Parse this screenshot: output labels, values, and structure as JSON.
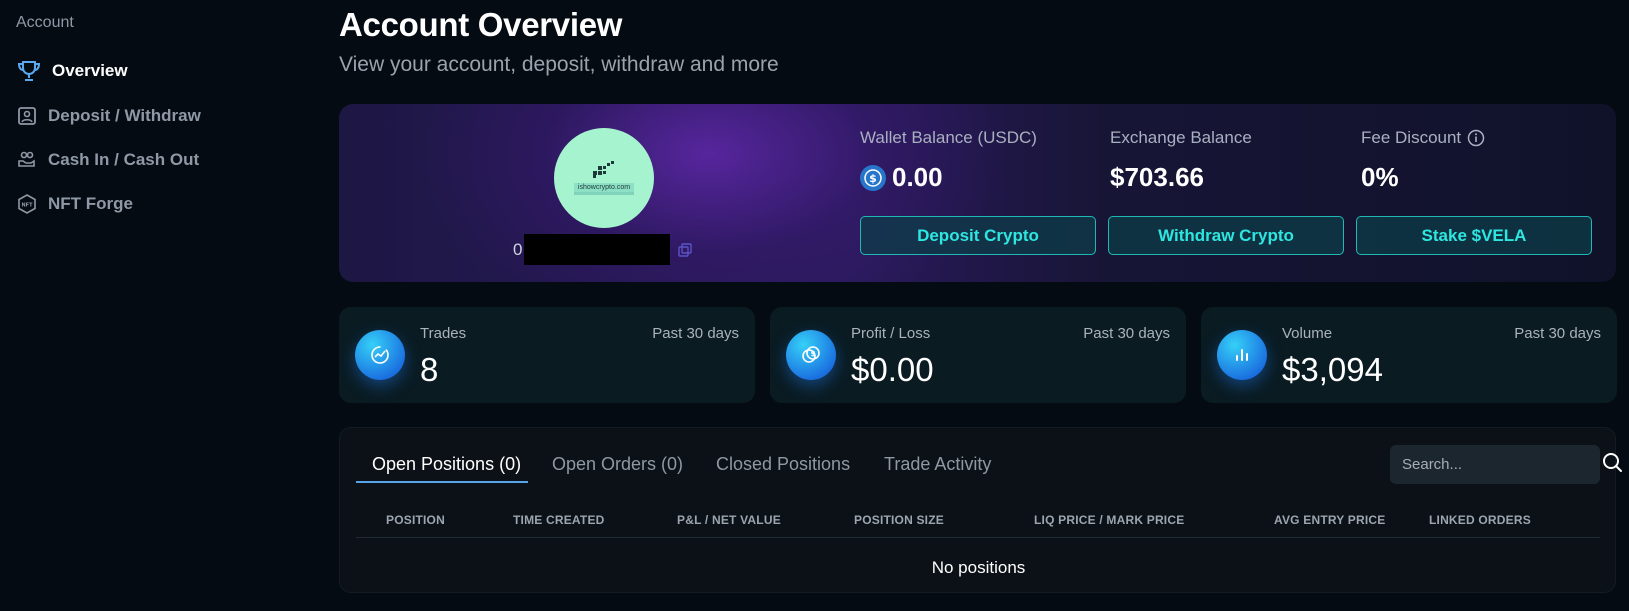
{
  "sidebar": {
    "section_title": "Account",
    "items": [
      {
        "label": "Overview",
        "icon": "trophy-icon",
        "active": true
      },
      {
        "label": "Deposit / Withdraw",
        "icon": "wallet-user-icon",
        "active": false
      },
      {
        "label": "Cash In / Cash Out",
        "icon": "hand-coin-icon",
        "active": false
      },
      {
        "label": "NFT Forge",
        "icon": "nft-hexagon-icon",
        "active": false
      }
    ]
  },
  "header": {
    "title": "Account Overview",
    "subtitle": "View your account, deposit, withdraw and more"
  },
  "account": {
    "avatar_text": "ishowcrypto.com",
    "address_prefix": "0",
    "wallet_balance": {
      "label": "Wallet Balance (USDC)",
      "value": "0.00"
    },
    "exchange_balance": {
      "label": "Exchange Balance",
      "value": "$703.66"
    },
    "fee_discount": {
      "label": "Fee Discount",
      "value": "0%"
    },
    "buttons": {
      "deposit": "Deposit Crypto",
      "withdraw": "Withdraw Crypto",
      "stake": "Stake $VELA"
    }
  },
  "metrics": [
    {
      "label": "Trades",
      "period": "Past 30 days",
      "value": "8",
      "icon": "chart-refresh-icon"
    },
    {
      "label": "Profit / Loss",
      "period": "Past 30 days",
      "value": "$0.00",
      "icon": "coins-icon"
    },
    {
      "label": "Volume",
      "period": "Past 30 days",
      "value": "$3,094",
      "icon": "bar-chart-icon"
    }
  ],
  "positions": {
    "tabs": [
      "Open Positions (0)",
      "Open Orders (0)",
      "Closed Positions",
      "Trade Activity"
    ],
    "active_tab": 0,
    "search_placeholder": "Search...",
    "columns": [
      "POSITION",
      "TIME CREATED",
      "P&L / NET VALUE",
      "POSITION SIZE",
      "LIQ PRICE / MARK PRICE",
      "AVG ENTRY PRICE",
      "LINKED ORDERS"
    ],
    "empty_message": "No positions"
  },
  "colors": {
    "background": "#050b12",
    "accent_cyan": "#2ee6e0",
    "tab_underline": "#57a3e8",
    "metric_icon": "#1a6ee0",
    "avatar": "#a6f3cf"
  }
}
